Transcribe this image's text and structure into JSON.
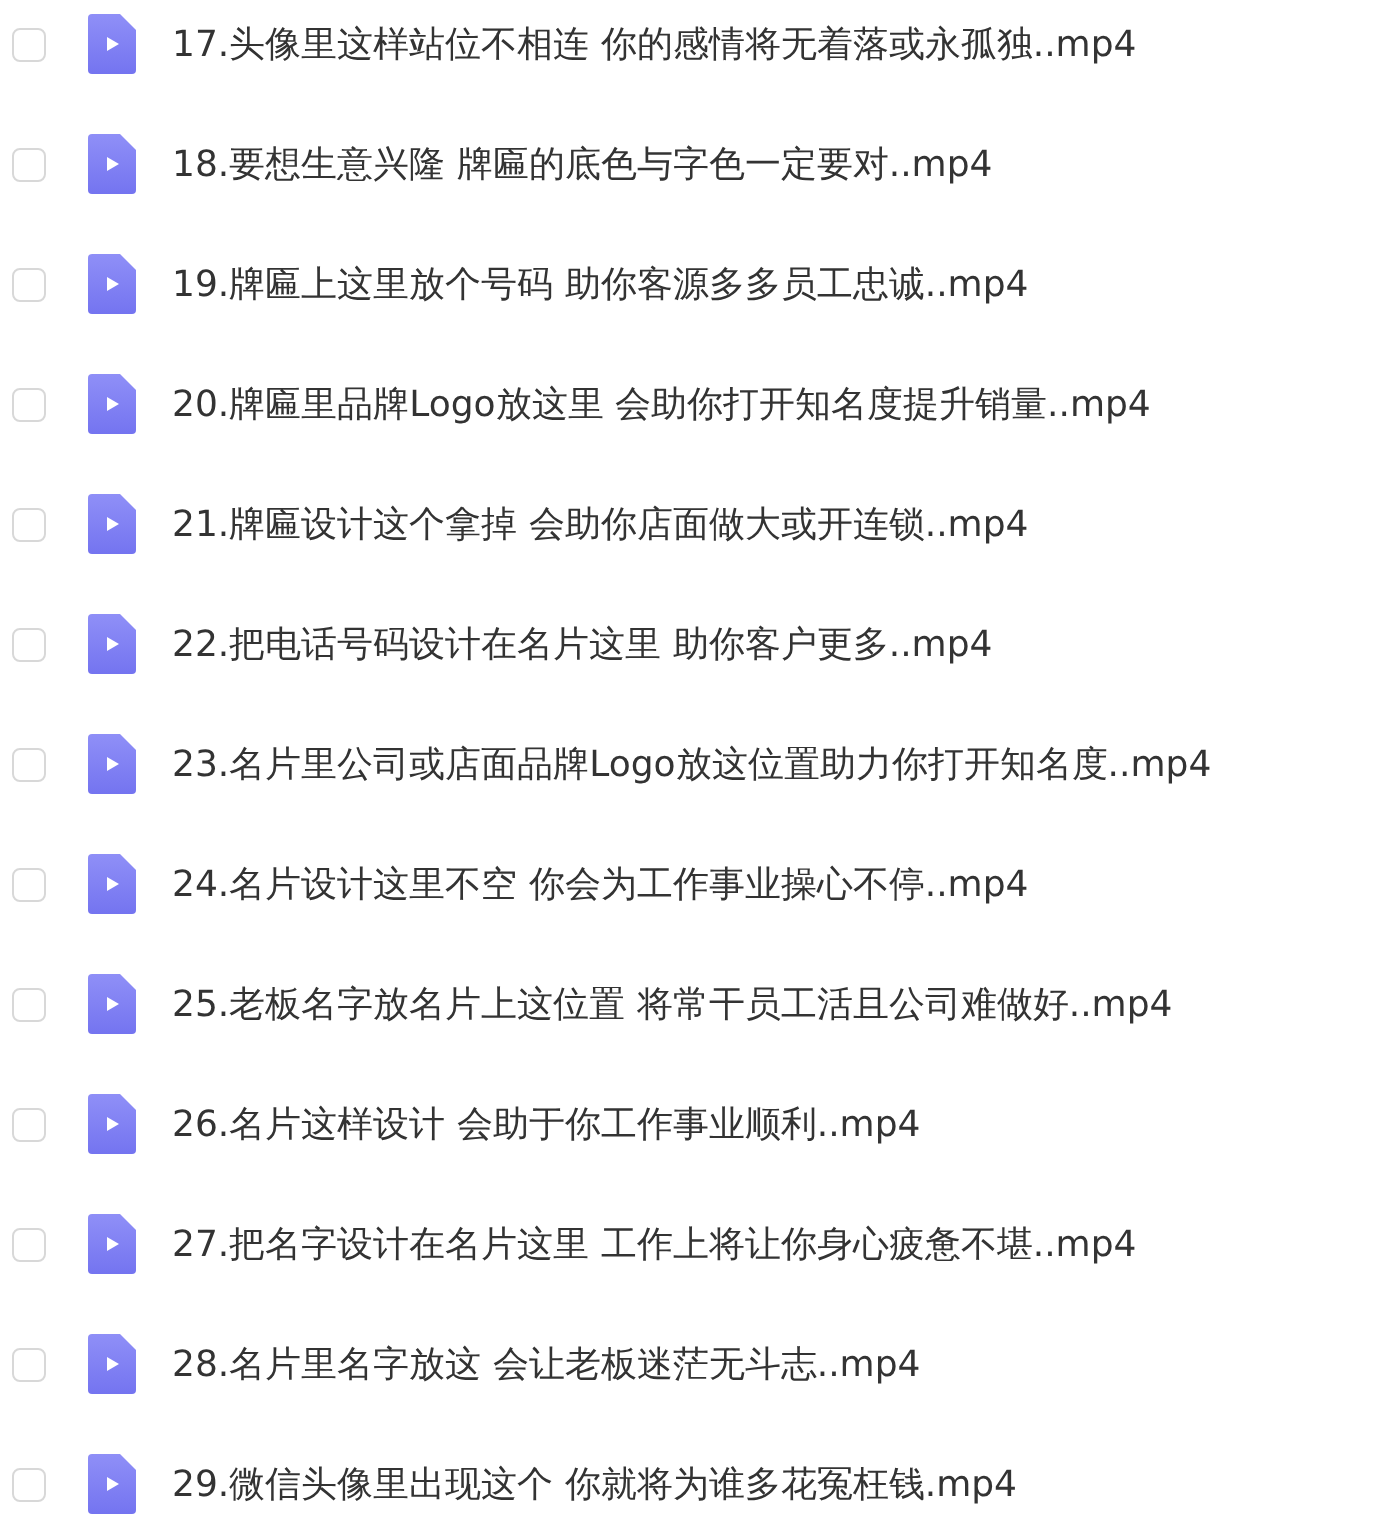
{
  "files": [
    {
      "name": "17.头像里这样站位不相连 你的感情将无着落或永孤独..mp4",
      "checked": false
    },
    {
      "name": "18.要想生意兴隆 牌匾的底色与字色一定要对..mp4",
      "checked": false
    },
    {
      "name": "19.牌匾上这里放个号码 助你客源多多员工忠诚..mp4",
      "checked": false
    },
    {
      "name": "20.牌匾里品牌Logo放这里 会助你打开知名度提升销量..mp4",
      "checked": false
    },
    {
      "name": "21.牌匾设计这个拿掉 会助你店面做大或开连锁..mp4",
      "checked": false
    },
    {
      "name": "22.把电话号码设计在名片这里 助你客户更多..mp4",
      "checked": false
    },
    {
      "name": "23.名片里公司或店面品牌Logo放这位置助力你打开知名度..mp4",
      "checked": false
    },
    {
      "name": "24.名片设计这里不空 你会为工作事业操心不停..mp4",
      "checked": false
    },
    {
      "name": "25.老板名字放名片上这位置 将常干员工活且公司难做好..mp4",
      "checked": false
    },
    {
      "name": "26.名片这样设计 会助于你工作事业顺利..mp4",
      "checked": false
    },
    {
      "name": "27.把名字设计在名片这里 工作上将让你身心疲惫不堪..mp4",
      "checked": false
    },
    {
      "name": "28.名片里名字放这 会让老板迷茫无斗志..mp4",
      "checked": false
    },
    {
      "name": "29.微信头像里出现这个 你就将为谁多花冤枉钱.mp4",
      "checked": false
    }
  ]
}
